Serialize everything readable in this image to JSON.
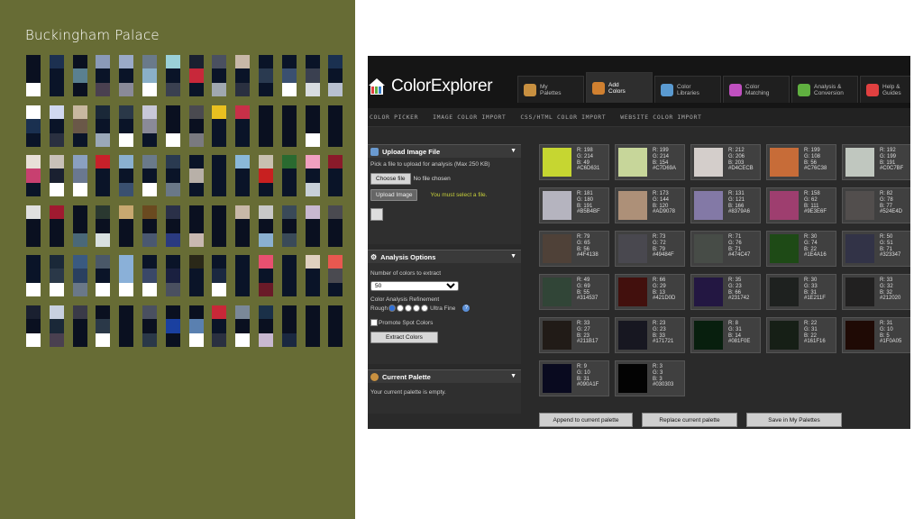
{
  "slide": {
    "title": "Buckingham Palace",
    "background": "#676c35",
    "strips": [
      [
        "#0a1020",
        "#0a1020",
        "#ffffff"
      ],
      [
        "#1c3050",
        "#0a1428",
        "#0a1428"
      ],
      [
        "#0a1020",
        "#5a8090",
        "#0a1020"
      ],
      [
        "#8a9ab8",
        "#0a1428",
        "#4a4050"
      ],
      [
        "#9aaac8",
        "#0a1428",
        "#8a8a98"
      ],
      [
        "#6a7a8a",
        "#8ab0c8",
        "#ffffff"
      ],
      [
        "#9ad0d8",
        "#0a1428",
        "#3a4050"
      ],
      [
        "#1a2030",
        "#c8283a",
        "#0a1428"
      ],
      [
        "#4a5060",
        "#0a1428",
        "#a0a8b0"
      ],
      [
        "#c8b8a8",
        "#0a1428",
        "#2a3040"
      ],
      [
        "#0a1428",
        "#2a3a50",
        "#0a1428"
      ],
      [
        "#0a1428",
        "#3a5070",
        "#ffffff"
      ],
      [
        "#0a1428",
        "#3a4050",
        "#d8dce0"
      ],
      [
        "#1a3050",
        "#0a1428",
        "#b8c0d0"
      ],
      [
        "#ffffff",
        "#1a3050",
        "#0a1428"
      ],
      [
        "#d0d8f0",
        "#0a1428",
        "#2a3040"
      ],
      [
        "#c8b8a0",
        "#6a5848",
        "#0a1428"
      ],
      [
        "#1a2838",
        "#0a1428",
        "#9aa8b8"
      ],
      [
        "#2a3848",
        "#0a1428",
        "#ffffff"
      ],
      [
        "#c8c8d8",
        "#8a8a98",
        "#0a1428"
      ],
      [
        "#0a1020",
        "#0a1020",
        "#ffffff"
      ],
      [
        "#4a4a50",
        "#0a1020",
        "#7a7a80"
      ],
      [
        "#e8c020",
        "#0a1428",
        "#0a1428"
      ],
      [
        "#c83048",
        "#0a1428",
        "#0a1428"
      ],
      [
        "#0a1020",
        "#0a1020",
        "#0a1020"
      ],
      [
        "#0a1020",
        "#0a1020",
        "#0a1020"
      ],
      [
        "#0a1020",
        "#0a1020",
        "#ffffff"
      ],
      [
        "#0a1020",
        "#0a1020",
        "#0a1020"
      ],
      [
        "#e8e0d8",
        "#c84070",
        "#0a1428"
      ],
      [
        "#c8c0b8",
        "#1a2030",
        "#ffffff"
      ],
      [
        "#8aa0c0",
        "#6a7890",
        "#ffffff"
      ],
      [
        "#c8202a",
        "#0a1428",
        "#0a1428"
      ],
      [
        "#8ab0d0",
        "#0a1428",
        "#3a5070"
      ],
      [
        "#6a7a8a",
        "#0a1428",
        "#ffffff"
      ],
      [
        "#2a3a50",
        "#0a1428",
        "#6a7888"
      ],
      [
        "#0a1428",
        "#b8b0a8",
        "#0a1428"
      ],
      [
        "#0a1428",
        "#0a1428",
        "#0a1428"
      ],
      [
        "#8ab8d8",
        "#0a1428",
        "#0a1428"
      ],
      [
        "#c8c0b0",
        "#c82020",
        "#0a1428"
      ],
      [
        "#2a6a30",
        "#0a1428",
        "#0a1428"
      ],
      [
        "#f0a0c0",
        "#0a1428",
        "#c8d0d8"
      ],
      [
        "#8a1a2a",
        "#0a1428",
        "#0a1428"
      ],
      [
        "#e0e0e0",
        "#0a1020",
        "#0a1020"
      ],
      [
        "#a01a30",
        "#0a1020",
        "#0a1020"
      ],
      [
        "#0a1020",
        "#0a1020",
        "#4a6878"
      ],
      [
        "#2a3830",
        "#0a1020",
        "#d8e0e0"
      ],
      [
        "#c8a870",
        "#0a1020",
        "#0a1020"
      ],
      [
        "#6a4a20",
        "#0a1020",
        "#4a5870"
      ],
      [
        "#2a3048",
        "#0a1020",
        "#2a3a80"
      ],
      [
        "#0a1020",
        "#0a1020",
        "#c8b8b0"
      ],
      [
        "#0a1020",
        "#0a1020",
        "#0a1020"
      ],
      [
        "#c8b8a8",
        "#0a1020",
        "#0a1020"
      ],
      [
        "#c8c8c8",
        "#0a1020",
        "#8ab0d0"
      ],
      [
        "#3a4a58",
        "#0a1020",
        "#3a4a58"
      ],
      [
        "#c8b8d0",
        "#0a1020",
        "#0a1020"
      ],
      [
        "#4a4a50",
        "#0a1020",
        "#0a1020"
      ],
      [
        "#0a1428",
        "#0a1428",
        "#ffffff"
      ],
      [
        "#1a2838",
        "#2a3848",
        "#ffffff"
      ],
      [
        "#3a5a80",
        "#2a4060",
        "#6a7888"
      ],
      [
        "#4a5868",
        "#0a1428",
        "#ffffff"
      ],
      [
        "#8ab0d8",
        "#8ab0d8",
        "#ffffff"
      ],
      [
        "#0a1428",
        "#3a4868",
        "#ffffff"
      ],
      [
        "#0a1428",
        "#1a2040",
        "#4a5060"
      ],
      [
        "#2a2818",
        "#0a1428",
        "#0a1428"
      ],
      [
        "#0a1428",
        "#1a2840",
        "#ffffff"
      ],
      [
        "#0a1428",
        "#0a1428",
        "#0a1428"
      ],
      [
        "#e85070",
        "#0a1428",
        "#6a1a28"
      ],
      [
        "#0a1428",
        "#0a1428",
        "#0a1428"
      ],
      [
        "#e0d0c0",
        "#0a1428",
        "#0a1428"
      ],
      [
        "#e85850",
        "#4a4a50",
        "#0a1428"
      ],
      [
        "#1a2030",
        "#0a1020",
        "#ffffff"
      ],
      [
        "#c8d0e0",
        "#1a2838",
        "#4a4050"
      ],
      [
        "#3a3a48",
        "#0a1020",
        "#0a1020"
      ],
      [
        "#0a1020",
        "#2a3848",
        "#ffffff"
      ],
      [
        "#0a1020",
        "#0a1020",
        "#0a1020"
      ],
      [
        "#4a5060",
        "#0a1020",
        "#2a3848"
      ],
      [
        "#0a1020",
        "#1a40a0",
        "#0a1020"
      ],
      [
        "#0a1020",
        "#5a80b0",
        "#ffffff"
      ],
      [
        "#c82838",
        "#0a1428",
        "#2a3040"
      ],
      [
        "#7a8898",
        "#0a1020",
        "#ffffff"
      ],
      [
        "#1a3048",
        "#0a1020",
        "#c8b8d0"
      ],
      [
        "#0a1020",
        "#0a1020",
        "#1a2840"
      ],
      [
        "#0a1020",
        "#0a1020",
        "#0a1020"
      ],
      [
        "#0a1020",
        "#0a1020",
        "#0a1020"
      ]
    ]
  },
  "app": {
    "logo": "ColorExplorer",
    "tabs": [
      {
        "label": "My\nPalettes",
        "icon": "palette-icon",
        "color": "#c89040"
      },
      {
        "label": "Add\nColors",
        "icon": "brush-icon",
        "color": "#d08030"
      },
      {
        "label": "Color\nLibraries",
        "icon": "library-icon",
        "color": "#5a9ad0"
      },
      {
        "label": "Color\nMatching",
        "icon": "color-wheel-icon",
        "color": "#c050c0"
      },
      {
        "label": "Analysis &\nConversion",
        "icon": "analysis-icon",
        "color": "#60b040"
      },
      {
        "label": "Help &\nGuides",
        "icon": "lifebuoy-icon",
        "color": "#e04040"
      }
    ],
    "subnav": [
      "COLOR PICKER",
      "IMAGE COLOR IMPORT",
      "CSS/HTML COLOR IMPORT",
      "WEBSITE COLOR IMPORT"
    ],
    "upload": {
      "title": "Upload Image File",
      "desc": "Pick a file to upload for analysis (Max 250 KB)",
      "choose": "Choose file",
      "nofile": "No file chosen",
      "upload_btn": "Upload Image",
      "warning": "You must select a file."
    },
    "analysis": {
      "title": "Analysis Options",
      "num_label": "Number of colors to extract",
      "num_value": "50",
      "refine_label": "Color Analysis Refinement",
      "rough": "Rough",
      "ultra": "Ultra Fine",
      "promote": "Promote Spot Colors",
      "extract_btn": "Extract Colors"
    },
    "palette": {
      "title": "Current Palette",
      "empty": "Your current palette is empty."
    },
    "swatches": [
      {
        "hex": "#C6D631",
        "r": "R: 198",
        "g": "G: 214",
        "b": "B: 49",
        "code": "#C6D631"
      },
      {
        "hex": "#C7D69A",
        "r": "R: 199",
        "g": "G: 214",
        "b": "B: 154",
        "code": "#C7D69A"
      },
      {
        "hex": "#D4CECB",
        "r": "R: 212",
        "g": "G: 206",
        "b": "B: 203",
        "code": "#D4CECB"
      },
      {
        "hex": "#C76C38",
        "r": "R: 199",
        "g": "G: 108",
        "b": "B: 56",
        "code": "#C76C38"
      },
      {
        "hex": "#C0C7BF",
        "r": "R: 192",
        "g": "G: 199",
        "b": "B: 191",
        "code": "#C0C7BF"
      },
      {
        "hex": "#B5B4BF",
        "r": "R: 181",
        "g": "G: 180",
        "b": "B: 191",
        "code": "#B5B4BF"
      },
      {
        "hex": "#AD9078",
        "r": "R: 173",
        "g": "G: 144",
        "b": "B: 120",
        "code": "#AD9078"
      },
      {
        "hex": "#8379A6",
        "r": "R: 131",
        "g": "G: 121",
        "b": "B: 166",
        "code": "#8379A6"
      },
      {
        "hex": "#9E3E6F",
        "r": "R: 158",
        "g": "G: 62",
        "b": "B: 111",
        "code": "#9E3E6F"
      },
      {
        "hex": "#524E4D",
        "r": "R: 82",
        "g": "G: 78",
        "b": "B: 77",
        "code": "#524E4D"
      },
      {
        "hex": "#4F4138",
        "r": "R: 79",
        "g": "G: 65",
        "b": "B: 56",
        "code": "#4F4138"
      },
      {
        "hex": "#49484F",
        "r": "R: 73",
        "g": "G: 72",
        "b": "B: 79",
        "code": "#49484F"
      },
      {
        "hex": "#474C47",
        "r": "R: 71",
        "g": "G: 76",
        "b": "B: 71",
        "code": "#474C47"
      },
      {
        "hex": "#1E4A16",
        "r": "R: 30",
        "g": "G: 74",
        "b": "B: 22",
        "code": "#1E4A16"
      },
      {
        "hex": "#323347",
        "r": "R: 50",
        "g": "G: 51",
        "b": "B: 71",
        "code": "#323347"
      },
      {
        "hex": "#314537",
        "r": "R: 49",
        "g": "G: 69",
        "b": "B: 55",
        "code": "#314537"
      },
      {
        "hex": "#42100D",
        "r": "R: 66",
        "g": "G: 29",
        "b": "B: 13",
        "code": "#421D0D"
      },
      {
        "hex": "#231742",
        "r": "R: 35",
        "g": "G: 23",
        "b": "B: 66",
        "code": "#231742"
      },
      {
        "hex": "#1E211F",
        "r": "R: 30",
        "g": "G: 33",
        "b": "B: 31",
        "code": "#1E211F"
      },
      {
        "hex": "#212020",
        "r": "R: 33",
        "g": "G: 32",
        "b": "B: 32",
        "code": "#212020"
      },
      {
        "hex": "#211B17",
        "r": "R: 33",
        "g": "G: 27",
        "b": "B: 23",
        "code": "#211B17"
      },
      {
        "hex": "#171721",
        "r": "R: 23",
        "g": "G: 23",
        "b": "B: 33",
        "code": "#171721"
      },
      {
        "hex": "#081F0E",
        "r": "R: 8",
        "g": "G: 31",
        "b": "B: 14",
        "code": "#081F0E"
      },
      {
        "hex": "#161F16",
        "r": "R: 22",
        "g": "G: 31",
        "b": "B: 22",
        "code": "#161F16"
      },
      {
        "hex": "#1F0A05",
        "r": "R: 31",
        "g": "G: 10",
        "b": "B: 5",
        "code": "#1F0A05"
      },
      {
        "hex": "#090A1F",
        "r": "R: 9",
        "g": "G: 10",
        "b": "B: 31",
        "code": "#090A1F"
      },
      {
        "hex": "#030303",
        "r": "R: 3",
        "g": "G: 3",
        "b": "B: 3",
        "code": "#030303"
      }
    ],
    "actions": [
      "Append to current palette",
      "Replace current palette",
      "Save in My Palettes"
    ]
  }
}
